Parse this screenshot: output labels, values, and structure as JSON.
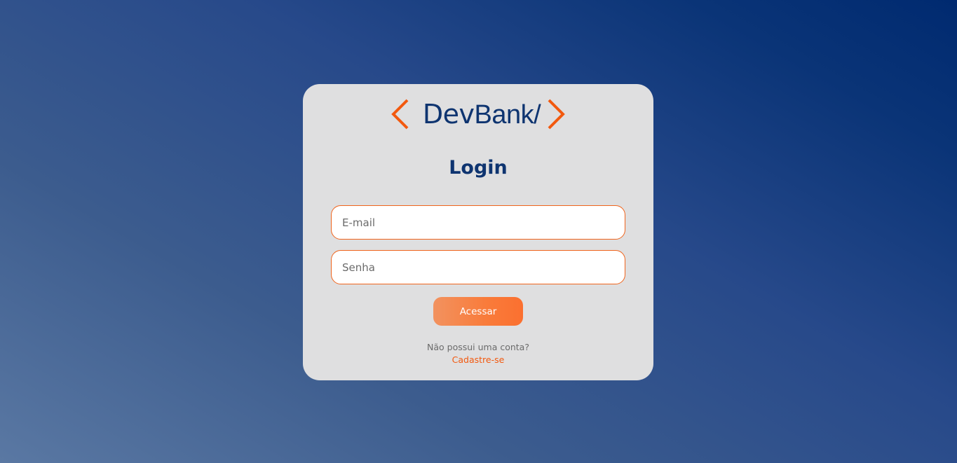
{
  "brand": {
    "name_bold": "Dev",
    "name_light": "Bank/",
    "accent_color": "#f2590f",
    "primary_color": "#0e3470",
    "left_icon": "chevron-left-icon",
    "right_icon": "chevron-right-icon"
  },
  "login": {
    "title": "Login",
    "email_placeholder": "E-mail",
    "email_value": "",
    "password_placeholder": "Senha",
    "password_value": "",
    "submit_label": "Acessar"
  },
  "footer": {
    "no_account_text": "Não possui uma conta?",
    "signup_link": "Cadastre-se"
  }
}
